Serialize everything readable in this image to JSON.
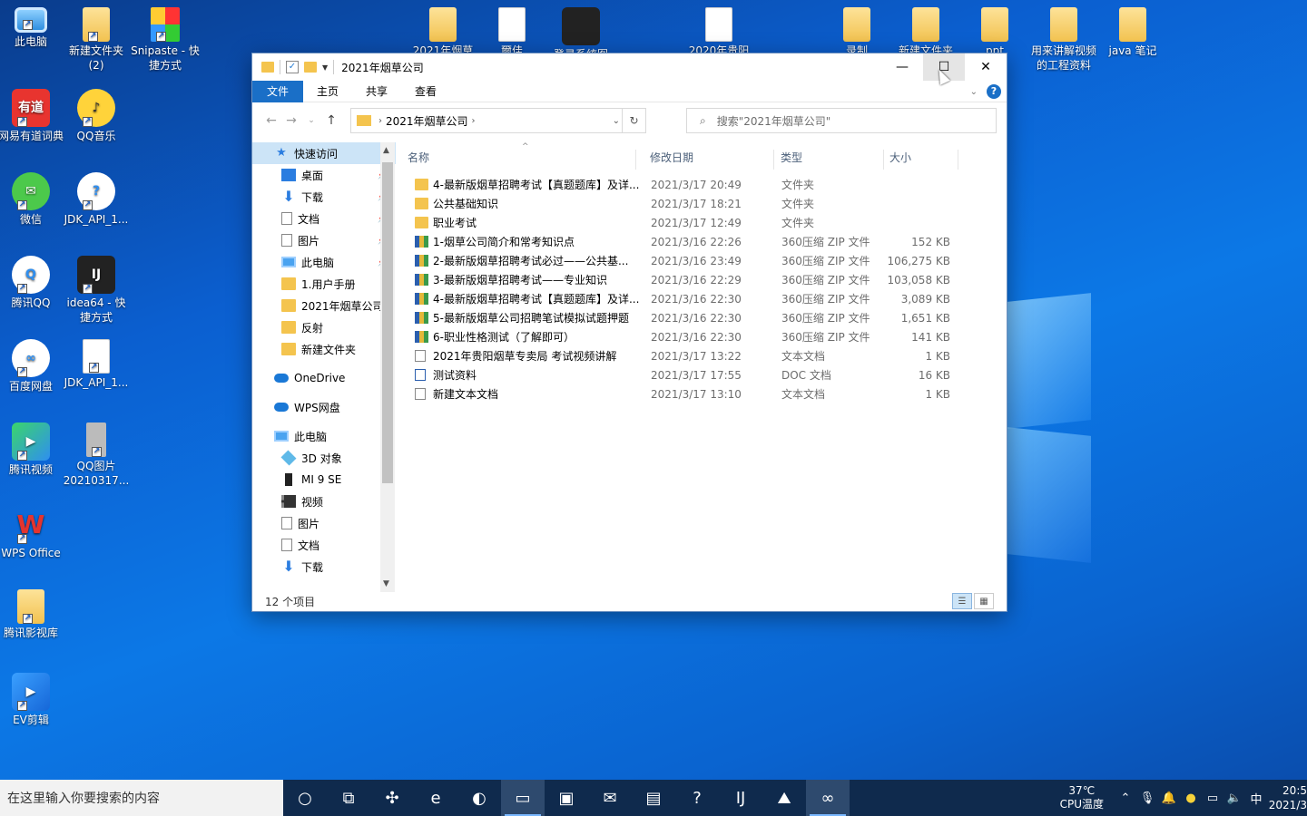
{
  "desktop": {
    "icons_left": [
      {
        "label": "此电脑",
        "kind": "pc",
        "glyph": ""
      },
      {
        "label": "新建文件夹 (2)",
        "kind": "folder",
        "glyph": ""
      },
      {
        "label": "Snipaste - 快捷方式",
        "kind": "multi",
        "glyph": ""
      },
      {
        "label": "网易有道词典",
        "kind": "app-red",
        "glyph": "有道"
      },
      {
        "label": "QQ音乐",
        "kind": "app-yellow",
        "glyph": "♪"
      },
      {
        "label": "微信",
        "kind": "app-green",
        "glyph": "✉"
      },
      {
        "label": "JDK_API_1...",
        "kind": "app-white",
        "glyph": "?"
      },
      {
        "label": "腾讯QQ",
        "kind": "app-white",
        "glyph": "Q"
      },
      {
        "label": "idea64 - 快捷方式",
        "kind": "app-dark",
        "glyph": "IJ"
      },
      {
        "label": "百度网盘",
        "kind": "app-white",
        "glyph": "∞"
      },
      {
        "label": "JDK_API_1...",
        "kind": "doc",
        "glyph": ""
      },
      {
        "label": "腾讯视频",
        "kind": "app-tv",
        "glyph": "▶"
      },
      {
        "label": "QQ图片20210317...",
        "kind": "gray",
        "glyph": ""
      },
      {
        "label": "WPS Office",
        "kind": "app-wps",
        "glyph": "W"
      },
      {
        "label": "腾讯影视库",
        "kind": "folder",
        "glyph": ""
      },
      {
        "label": "EV剪辑",
        "kind": "app-ev",
        "glyph": "▶"
      }
    ],
    "icons_top": [
      {
        "label": "2021年烟草",
        "kind": "folder"
      },
      {
        "label": "爾佳",
        "kind": "doc"
      },
      {
        "label": "登录系统图",
        "kind": "app-dark"
      },
      {
        "label": "2020年贵阳",
        "kind": "doc"
      },
      {
        "label": "录制",
        "kind": "folder"
      },
      {
        "label": "新建文件夹",
        "kind": "folder"
      },
      {
        "label": "ppt",
        "kind": "folder"
      },
      {
        "label": "用来讲解视频的工程资料",
        "kind": "folder"
      },
      {
        "label": "java 笔记",
        "kind": "folder"
      }
    ]
  },
  "window": {
    "title": "2021年烟草公司",
    "controls": {
      "minimize": "—",
      "maximize": "☐",
      "close": "✕"
    },
    "ribbon_tabs": [
      "文件",
      "主页",
      "共享",
      "查看"
    ],
    "address": {
      "crumb": "2021年烟草公司"
    },
    "search_placeholder": "搜索\"2021年烟草公司\"",
    "nav": [
      {
        "label": "快速访问",
        "icon": "star",
        "level": 0,
        "pinned": false,
        "selected": true
      },
      {
        "label": "桌面",
        "icon": "blue",
        "level": 1,
        "pinned": true
      },
      {
        "label": "下载",
        "icon": "arrow",
        "level": 1,
        "pinned": true
      },
      {
        "label": "文档",
        "icon": "doc",
        "level": 1,
        "pinned": true
      },
      {
        "label": "图片",
        "icon": "doc",
        "level": 1,
        "pinned": true
      },
      {
        "label": "此电脑",
        "icon": "pc",
        "level": 1,
        "pinned": true
      },
      {
        "label": "1.用户手册",
        "icon": "fld",
        "level": 1,
        "pinned": false
      },
      {
        "label": "2021年烟草公司",
        "icon": "fld",
        "level": 1,
        "pinned": false
      },
      {
        "label": "反射",
        "icon": "fld",
        "level": 1,
        "pinned": false
      },
      {
        "label": "新建文件夹",
        "icon": "fld",
        "level": 1,
        "pinned": false
      },
      {
        "label": "",
        "icon": "",
        "level": -1
      },
      {
        "label": "OneDrive",
        "icon": "cloud",
        "level": 0,
        "pinned": false
      },
      {
        "label": "",
        "icon": "",
        "level": -1
      },
      {
        "label": "WPS网盘",
        "icon": "cloud",
        "level": 0,
        "pinned": false
      },
      {
        "label": "",
        "icon": "",
        "level": -1
      },
      {
        "label": "此电脑",
        "icon": "pc",
        "level": 0,
        "pinned": false
      },
      {
        "label": "3D 对象",
        "icon": "cube",
        "level": 1,
        "pinned": false
      },
      {
        "label": "MI 9 SE",
        "icon": "phone",
        "level": 1,
        "pinned": false
      },
      {
        "label": "视频",
        "icon": "video",
        "level": 1,
        "pinned": false
      },
      {
        "label": "图片",
        "icon": "doc",
        "level": 1,
        "pinned": false
      },
      {
        "label": "文档",
        "icon": "doc",
        "level": 1,
        "pinned": false
      },
      {
        "label": "下载",
        "icon": "arrow",
        "level": 1,
        "pinned": false
      }
    ],
    "columns": {
      "name": "名称",
      "date": "修改日期",
      "type": "类型",
      "size": "大小"
    },
    "files": [
      {
        "name": "4-最新版烟草招聘考试【真题题库】及详...",
        "date": "2021/3/17 20:49",
        "type": "文件夹",
        "size": "",
        "icon": "folder"
      },
      {
        "name": "公共基础知识",
        "date": "2021/3/17 18:21",
        "type": "文件夹",
        "size": "",
        "icon": "folder"
      },
      {
        "name": "职业考试",
        "date": "2021/3/17 12:49",
        "type": "文件夹",
        "size": "",
        "icon": "folder"
      },
      {
        "name": "1-烟草公司简介和常考知识点",
        "date": "2021/3/16 22:26",
        "type": "360压缩 ZIP 文件",
        "size": "152 KB",
        "icon": "zip"
      },
      {
        "name": "2-最新版烟草招聘考试必过——公共基...",
        "date": "2021/3/16 23:49",
        "type": "360压缩 ZIP 文件",
        "size": "106,275 KB",
        "icon": "zip"
      },
      {
        "name": "3-最新版烟草招聘考试——专业知识",
        "date": "2021/3/16 22:29",
        "type": "360压缩 ZIP 文件",
        "size": "103,058 KB",
        "icon": "zip"
      },
      {
        "name": "4-最新版烟草招聘考试【真题题库】及详...",
        "date": "2021/3/16 22:30",
        "type": "360压缩 ZIP 文件",
        "size": "3,089 KB",
        "icon": "zip"
      },
      {
        "name": "5-最新版烟草公司招聘笔试模拟试题押题",
        "date": "2021/3/16 22:30",
        "type": "360压缩 ZIP 文件",
        "size": "1,651 KB",
        "icon": "zip"
      },
      {
        "name": "6-职业性格测试（了解即可）",
        "date": "2021/3/16 22:30",
        "type": "360压缩 ZIP 文件",
        "size": "141 KB",
        "icon": "zip"
      },
      {
        "name": "2021年贵阳烟草专卖局 考试视频讲解",
        "date": "2021/3/17 13:22",
        "type": "文本文档",
        "size": "1 KB",
        "icon": "txt"
      },
      {
        "name": "测试资料",
        "date": "2021/3/17 17:55",
        "type": "DOC 文档",
        "size": "16 KB",
        "icon": "doc"
      },
      {
        "name": "新建文本文档",
        "date": "2021/3/17 13:10",
        "type": "文本文档",
        "size": "1 KB",
        "icon": "txt"
      }
    ],
    "status": "12 个项目"
  },
  "taskbar": {
    "search_placeholder": "在这里输入你要搜索的内容",
    "apps": [
      {
        "name": "cortana-icon",
        "glyph": "○",
        "active": false
      },
      {
        "name": "task-view-icon",
        "glyph": "⧉",
        "active": false
      },
      {
        "name": "pinwheel-icon",
        "glyph": "✣",
        "active": false
      },
      {
        "name": "ie-icon",
        "glyph": "e",
        "active": false
      },
      {
        "name": "edge-icon",
        "glyph": "◐",
        "active": false
      },
      {
        "name": "file-explorer-icon",
        "glyph": "▭",
        "active": true
      },
      {
        "name": "store-icon",
        "glyph": "▣",
        "active": false
      },
      {
        "name": "mail-icon",
        "glyph": "✉",
        "active": false
      },
      {
        "name": "notepad-icon",
        "glyph": "▤",
        "active": false
      },
      {
        "name": "jdk-api-icon",
        "glyph": "?",
        "active": false
      },
      {
        "name": "idea-icon",
        "glyph": "IJ",
        "active": false
      },
      {
        "name": "photos-icon",
        "glyph": "⛰",
        "active": false
      },
      {
        "name": "baidu-netdisk-icon",
        "glyph": "∞",
        "active": true
      }
    ],
    "temperature": "37℃",
    "temp_label": "CPU温度",
    "ime": "中",
    "time": "20:5",
    "date": "2021/3"
  }
}
